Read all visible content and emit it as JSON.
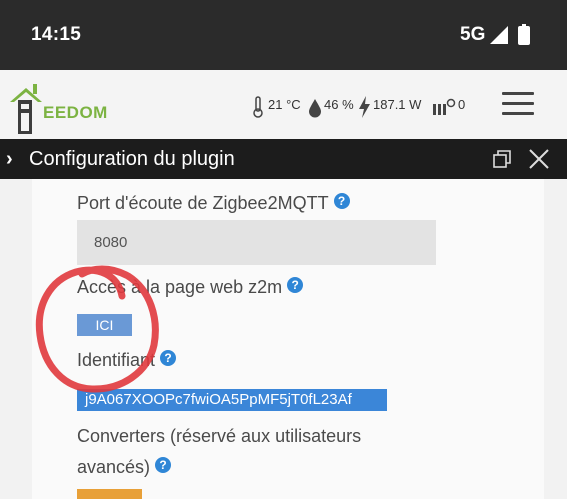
{
  "status_bar": {
    "time": "14:15",
    "network": "5G"
  },
  "header": {
    "logo_text": "EEDOM",
    "temperature": "21 °C",
    "humidity": "46 %",
    "power": "187.1 W",
    "heating": "0"
  },
  "modal": {
    "title": "Configuration du plugin"
  },
  "form": {
    "port_label": "Port d'écoute de Zigbee2MQTT",
    "port_value": "8080",
    "web_label": "Accès à la page web z2m",
    "web_button": "ICI",
    "id_label": "Identifiant",
    "id_value": "j9A067XOOPc7fwiOA5PpMF5jT0fL23Af",
    "converters_label_1": "Converters (réservé aux utilisateurs",
    "converters_label_2": "avancés)"
  },
  "colors": {
    "status_bg": "#2b2b2b",
    "titlebar_bg": "#1c1c1c",
    "logo_green": "#7cb342",
    "help_blue": "#2f86d6",
    "button_blue": "#6a99d6",
    "annotation_red": "#e0383d",
    "orange": "#e8a038"
  }
}
